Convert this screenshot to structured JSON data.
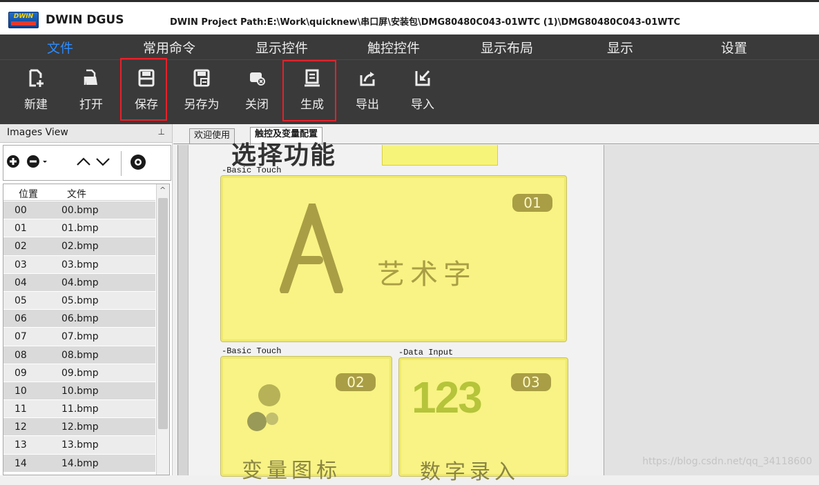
{
  "titlebar": {
    "logo_text": "DWIN",
    "app_name": "DWIN DGUS",
    "project_path": "DWIN Project Path:E:\\Work\\quicknew\\串口屏\\安装包\\DMG80480C043-01WTC (1)\\DMG80480C043-01WTC"
  },
  "menu": {
    "items": [
      "文件",
      "常用命令",
      "显示控件",
      "触控控件",
      "显示布局",
      "显示",
      "设置"
    ],
    "active": "文件"
  },
  "toolbar": {
    "items": [
      {
        "label": "新建",
        "icon": "new-file-icon"
      },
      {
        "label": "打开",
        "icon": "open-folder-icon"
      },
      {
        "label": "保存",
        "icon": "save-icon"
      },
      {
        "label": "另存为",
        "icon": "save-as-icon"
      },
      {
        "label": "关闭",
        "icon": "close-project-icon"
      },
      {
        "label": "生成",
        "icon": "generate-icon"
      },
      {
        "label": "导出",
        "icon": "export-icon"
      },
      {
        "label": "导入",
        "icon": "import-icon"
      }
    ],
    "highlighted": [
      "保存",
      "生成"
    ],
    "highlight_color": "#e8202a"
  },
  "images_view": {
    "title": "Images View",
    "pin_icon": "pin-icon",
    "tools": [
      "add-icon",
      "remove-dropdown-icon",
      "move-up-icon",
      "move-down-icon",
      "preview-eye-icon"
    ],
    "columns": [
      "位置",
      "文件"
    ],
    "rows": [
      {
        "pos": "00",
        "file": "00.bmp"
      },
      {
        "pos": "01",
        "file": "01.bmp"
      },
      {
        "pos": "02",
        "file": "02.bmp"
      },
      {
        "pos": "03",
        "file": "03.bmp"
      },
      {
        "pos": "04",
        "file": "04.bmp"
      },
      {
        "pos": "05",
        "file": "05.bmp"
      },
      {
        "pos": "06",
        "file": "06.bmp"
      },
      {
        "pos": "07",
        "file": "07.bmp"
      },
      {
        "pos": "08",
        "file": "08.bmp"
      },
      {
        "pos": "09",
        "file": "09.bmp"
      },
      {
        "pos": "10",
        "file": "10.bmp"
      },
      {
        "pos": "11",
        "file": "11.bmp"
      },
      {
        "pos": "12",
        "file": "12.bmp"
      },
      {
        "pos": "13",
        "file": "13.bmp"
      },
      {
        "pos": "14",
        "file": "14.bmp"
      }
    ]
  },
  "tabs": {
    "items": [
      "欢迎使用",
      "触控及变量配置"
    ],
    "active": "触控及变量配置"
  },
  "canvas": {
    "heading_cut": "选择功能",
    "cards": [
      {
        "caption": "-Basic Touch",
        "badge": "01",
        "label": "艺术字",
        "glyph": "A"
      },
      {
        "caption": "-Basic Touch",
        "badge": "02",
        "label": "变量图标"
      },
      {
        "caption": "-Data Input",
        "badge": "03",
        "label": "数字录入",
        "number": "123"
      }
    ],
    "card_color": "#f8f384",
    "badge_color": "#a99e45"
  },
  "watermark": "https://blog.csdn.net/qq_34118600"
}
